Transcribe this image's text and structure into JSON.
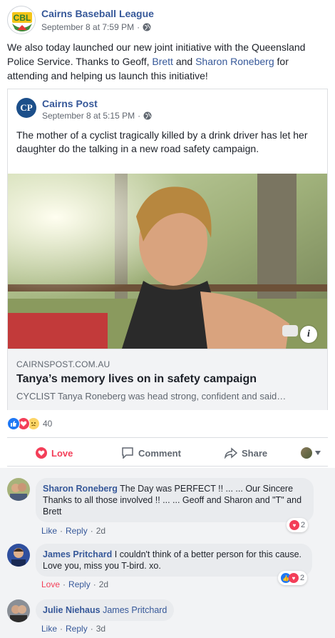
{
  "post": {
    "page_name": "Cairns Baseball League",
    "timestamp": "September 8 at 7:59 PM",
    "logo_text": "CBL",
    "text_before": "We also today launched our new joint initiative with the Queensland Police Service. Thanks to Geoff, ",
    "tag_1": "Brett",
    "text_middle": " and ",
    "tag_2": "Sharon Roneberg",
    "text_after": " for attending and helping us launch this initiative!"
  },
  "shared": {
    "page_name": "Cairns Post",
    "logo_text": "CP",
    "timestamp": "September 8 at 5:15 PM",
    "text": "The mother of a cyclist tragically killed by a drink driver has let her daughter do the talking in a new road safety campaign.",
    "info_icon": "i",
    "link_domain": "CAIRNSPOST.COM.AU",
    "link_title": "Tanya’s memory lives on in safety campaign",
    "link_desc": "CYCLIST Tanya Roneberg was head strong, confident and said…"
  },
  "reactions": {
    "count": "40",
    "types": [
      "like-icon",
      "love-icon",
      "sad-icon"
    ]
  },
  "actions": {
    "love": "Love",
    "comment": "Comment",
    "share": "Share"
  },
  "comments": [
    {
      "author": "Sharon Roneberg",
      "text": "The Day was PERFECT !! ... ... Our Sincere Thanks to all those involved !! ... ... Geoff and Sharon and \"T\" and Brett",
      "like": "Like",
      "reply": "Reply",
      "time": "2d",
      "reaction_count": "2"
    },
    {
      "author": "James Pritchard",
      "text": "I couldn't think of a better person for this cause. Love you, miss you T-bird. xo.",
      "like": "Love",
      "reply": "Reply",
      "time": "2d",
      "reaction_count": "2"
    },
    {
      "author": "Julie Niehaus",
      "tag": "James Pritchard",
      "like": "Like",
      "reply": "Reply",
      "time": "3d"
    }
  ],
  "colors": {
    "link_blue": "#365899",
    "love_red": "#f33e58",
    "like_blue": "#2078f4"
  }
}
